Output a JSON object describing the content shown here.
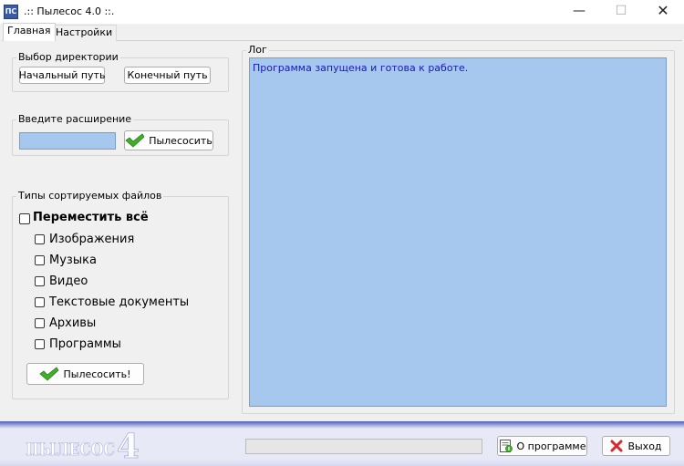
{
  "window": {
    "icon_text": "ПС",
    "title": ".:: Пылесос 4.0 ::.",
    "min_symbol": "—",
    "max_symbol": "☐",
    "close_symbol": "✕"
  },
  "tabs": [
    {
      "label": "Главная",
      "active": true
    },
    {
      "label": "Настройки",
      "active": false
    }
  ],
  "directory_group": {
    "legend": "Выбор директории",
    "start_button": "Начальный путь",
    "end_button": "Конечный путь"
  },
  "extension_group": {
    "legend": "Введите расширение",
    "input_value": "",
    "vacuum_button": "Пылесосить"
  },
  "file_types_group": {
    "legend": "Типы сортируемых файлов",
    "move_all": {
      "label": "Переместить всё",
      "checked": false
    },
    "types": [
      {
        "label": "Изображения",
        "checked": false
      },
      {
        "label": "Музыка",
        "checked": false
      },
      {
        "label": "Видео",
        "checked": false
      },
      {
        "label": "Текстовые документы",
        "checked": false
      },
      {
        "label": "Архивы",
        "checked": false
      },
      {
        "label": "Программы",
        "checked": false
      }
    ],
    "vacuum_button": "Пылесосить!"
  },
  "log": {
    "legend": "Лог",
    "lines": [
      "Программа запущена и готова к работе."
    ]
  },
  "bottom": {
    "logo_text": "ПЫЛЕСОС",
    "logo_number": "4",
    "progress": 0,
    "about_button": "О программе",
    "exit_button": "Выход"
  },
  "icons": {
    "checkmark": "checkmark-icon",
    "about": "about-icon",
    "exit": "exit-x-icon"
  },
  "colors": {
    "log_background": "#a6c8ef",
    "log_text": "#1a18b8",
    "input_background": "#a6c8ef",
    "check_green": "#3fae2a",
    "exit_red": "#d8262b"
  }
}
